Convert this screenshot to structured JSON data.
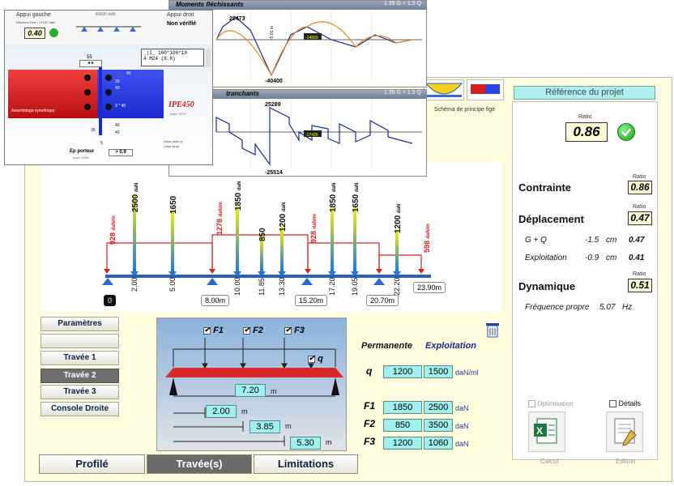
{
  "mainwin": {
    "beam": {
      "loads": [
        {
          "pos": "2.00",
          "value": "2500",
          "unit": "daN"
        },
        {
          "pos": "5.00",
          "value": "1650",
          "unit": "daN"
        },
        {
          "pos": "10.00",
          "value": "1850",
          "unit": "daN"
        },
        {
          "pos": "11.85",
          "value": "850",
          "unit": "daN"
        },
        {
          "pos": "13.30",
          "value": "1200",
          "unit": "daN"
        },
        {
          "pos": "17.20",
          "value": "1850",
          "unit": "daN"
        },
        {
          "pos": "19.05",
          "value": "1650",
          "unit": "daN"
        },
        {
          "pos": "22.20",
          "value": "1200",
          "unit": "daN"
        }
      ],
      "distributed": [
        {
          "value": "928",
          "unit": "daN/m"
        },
        {
          "value": "1278",
          "unit": "daN/m"
        },
        {
          "value": "928",
          "unit": "daN/m"
        },
        {
          "value": "598",
          "unit": "daN/m"
        }
      ],
      "supports": [
        "0",
        "8.00m",
        "15.20m",
        "20.70m"
      ],
      "end_label": "23.90m",
      "schema_label": "Schéma de principe figé",
      "watermark": "mente"
    },
    "nav": {
      "items": [
        "Paramètres",
        "",
        "Travée 1",
        "Travée 2",
        "Travée 3",
        "Console Droite"
      ],
      "selected": 3
    },
    "tabs": [
      "Profilé",
      "Travée(s)",
      "Limitations"
    ],
    "span": {
      "f1_label": "F1",
      "f2_label": "F2",
      "f3_label": "F3",
      "q_label": "q",
      "dims": [
        {
          "value": "7.20",
          "unit": "m"
        },
        {
          "value": "2.00",
          "unit": "m"
        },
        {
          "value": "3.85",
          "unit": "m"
        },
        {
          "value": "5.30",
          "unit": "m"
        }
      ]
    },
    "values_table": {
      "head_perm": "Permanente",
      "head_expl": "Exploitation",
      "rows": [
        {
          "label": "q",
          "perm": "1200",
          "expl": "1500",
          "unit": "daN/ml"
        },
        {
          "label": "F1",
          "perm": "1850",
          "expl": "2500",
          "unit": "daN"
        },
        {
          "label": "F2",
          "perm": "850",
          "expl": "3500",
          "unit": "daN"
        },
        {
          "label": "F3",
          "perm": "1200",
          "expl": "1060",
          "unit": "daN"
        }
      ]
    },
    "right": {
      "header": "Référence du projet",
      "ratio_label": "Ratio",
      "ratio": "0.86",
      "contrainte_label": "Contrainte",
      "contrainte": "0.86",
      "deplacement_label": "Déplacement",
      "deplacement": "0.47",
      "gq_label": "G + Q",
      "gq_val": "-1.5",
      "gq_unit": "cm",
      "gq_ratio": "0.47",
      "expl_label": "Exploitation",
      "expl_val": "-0.9",
      "expl_unit": "cm",
      "expl_ratio": "0.41",
      "dynamique_label": "Dynamique",
      "dynamique": "0.51",
      "freq_label": "Fréquence propre",
      "freq_val": "5.07",
      "freq_unit": "Hz",
      "optim_label": "Optimisation",
      "details_label": "Détails",
      "calcul_label": "Calcul",
      "edition_label": "Edition"
    }
  },
  "popup_moments": {
    "title": "Moments fléchissants",
    "combo": "1.35 G + 1.5 Q",
    "max": "28473",
    "min": "-40400",
    "note": "-5.01 m",
    "badge": "-14569"
  },
  "popup_shear": {
    "title": "tranchants",
    "combo": "1.35 G + 1.5 Q",
    "max": "25289",
    "min": "-25514",
    "badge": "-17426"
  },
  "popup_support": {
    "appui_gauche": "Appui gauche",
    "appui_droit": "Appui droit",
    "verif": "Non vérifié",
    "reaction": "Réaction Vsd = 17197 daN",
    "vrd": "42600 daN",
    "ratio": "0.40",
    "profile": "_|I_ 100*100*10",
    "bolts": "4 M24 (8.8)",
    "dim_top": "55",
    "section": "IPE450",
    "section_sub": "Acier S275",
    "bolt_dims": [
      "40",
      "20",
      "40",
      "3 * 45",
      "40",
      "35",
      "40",
      "5"
    ],
    "assembly": "Assemblage symétrique",
    "support_label": "Ep porteur",
    "support_sub": "Acier S235",
    "support_val": "> 0.9",
    "pos_label": "Lisse porte-g.",
    "pos_sub": "Lisse simp."
  }
}
